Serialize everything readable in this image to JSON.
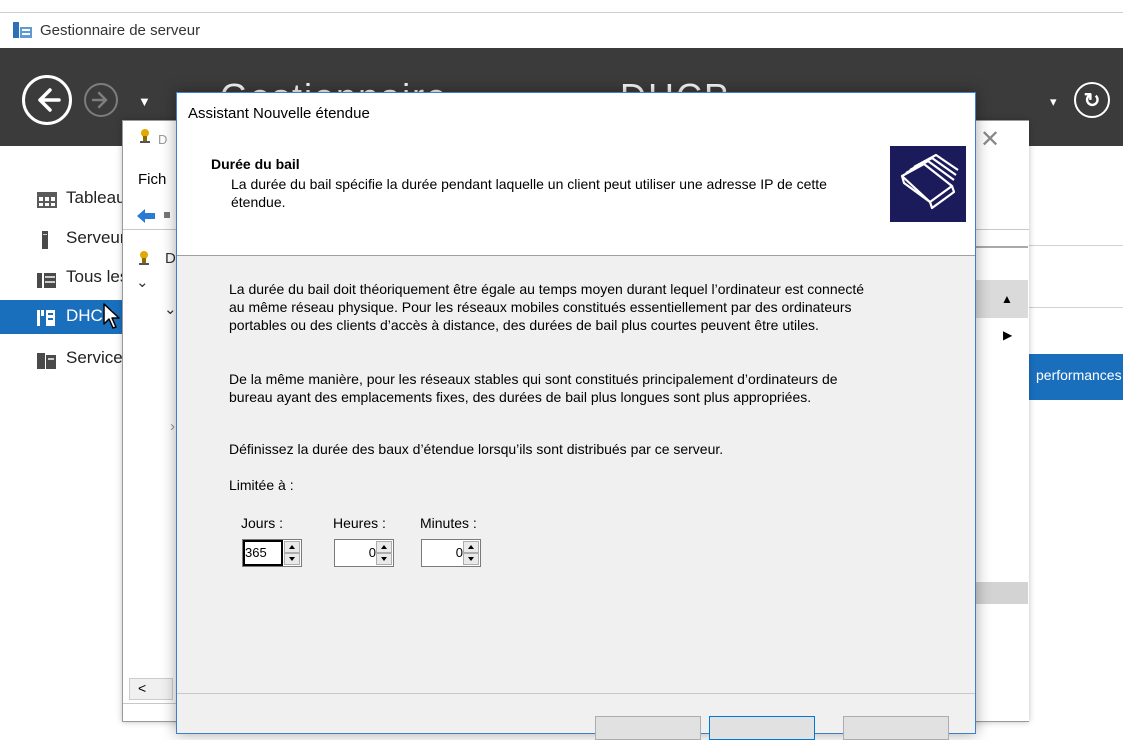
{
  "server_manager": {
    "title": "Gestionnaire de serveur",
    "header_title_left": "Gestionnaire",
    "header_title_right": "DHCP",
    "sidebar": [
      {
        "label": "Tableau de bord",
        "icon": "dashboard-icon"
      },
      {
        "label": "Serveur local",
        "icon": "server-icon"
      },
      {
        "label": "Tous les serveurs",
        "icon": "servers-icon"
      },
      {
        "label": "DHCP",
        "icon": "dhcp-icon",
        "active": true
      },
      {
        "label": "Services de fichiers",
        "icon": "file-services-icon"
      }
    ],
    "right_banner": "performances"
  },
  "mmc": {
    "title": "D",
    "menu": "Fich",
    "tree_root": "D",
    "scroll_left": "<",
    "scroll_up": "▲",
    "expand": "▶"
  },
  "wizard": {
    "title": "Assistant Nouvelle étendue",
    "heading": "Durée du bail",
    "subheading": "La durée du bail spécifie la durée pendant laquelle un client peut utiliser une adresse IP de cette étendue.",
    "paragraph1": "La durée du bail doit théoriquement être égale au temps moyen durant lequel l’ordinateur est connecté au même réseau physique. Pour les réseaux mobiles constitués essentiellement par des ordinateurs portables ou des clients d’accès à distance, des durées de bail plus courtes peuvent être utiles.",
    "paragraph2": "De la même manière, pour les réseaux stables qui sont constitués principalement d’ordinateurs de bureau ayant des emplacements fixes, des durées de bail plus longues sont plus appropriées.",
    "paragraph3": "Définissez la durée des baux d’étendue lorsqu’ils sont distribués par ce serveur.",
    "limit_label": "Limitée à :",
    "days_label": "Jours :",
    "hours_label": "Heures :",
    "minutes_label": "Minutes :",
    "days_value": "365",
    "hours_value": "0",
    "minutes_value": "0"
  },
  "colors": {
    "header_bg": "#3b3b3b",
    "accent_blue": "#1a6fbd",
    "wizard_icon_bg": "#1b1a5a"
  }
}
